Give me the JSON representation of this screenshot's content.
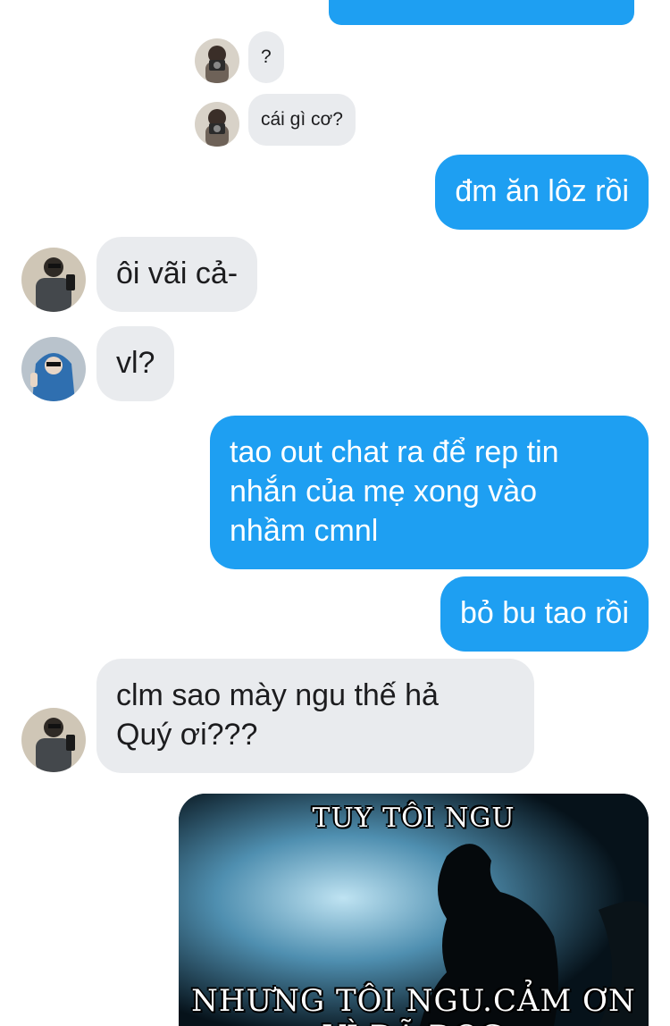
{
  "conversation": {
    "messages": [
      {
        "id": "m1",
        "side": "incoming",
        "text": "?"
      },
      {
        "id": "m2",
        "side": "incoming",
        "text": "cái gì cơ?"
      },
      {
        "id": "m3",
        "side": "outgoing",
        "text": "đm ăn lôz rồi"
      },
      {
        "id": "m4",
        "side": "incoming",
        "text": "ôi vãi cả-"
      },
      {
        "id": "m5",
        "side": "incoming",
        "text": "vl?"
      },
      {
        "id": "m6",
        "side": "outgoing",
        "lines": [
          "tao out chat ra để rep tin",
          "nhắn của mẹ xong vào",
          "nhầm cmnl"
        ]
      },
      {
        "id": "m7",
        "side": "outgoing",
        "text": "bỏ bu tao rồi"
      },
      {
        "id": "m8",
        "side": "incoming",
        "lines": [
          "clm sao mày ngu thế hả",
          "Quý ơi???"
        ]
      }
    ],
    "meme": {
      "top_caption": "TUY TÔI NGU",
      "bottom_caption": "NHƯNG TÔI NGU.CẢM ƠN VÌ ĐÃ ĐỌC"
    }
  },
  "colors": {
    "outgoing_bubble": "#1e9ff2",
    "incoming_bubble": "#e9ebee",
    "incoming_text": "#1c1c1e",
    "outgoing_text": "#ffffff"
  },
  "icons": {
    "avatar_camera": "avatar-camera-user",
    "avatar_selfie": "avatar-selfie-user",
    "avatar_hoodie": "avatar-blue-hoodie-user"
  }
}
